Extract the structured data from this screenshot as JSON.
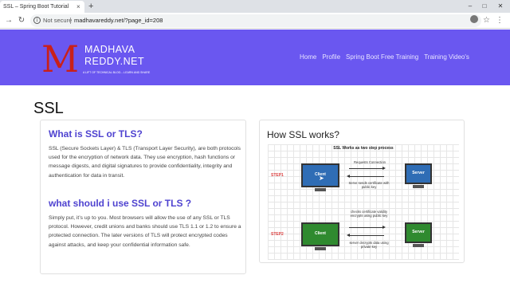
{
  "browser": {
    "tab_title": "SSL – Spring Boot Tutorial",
    "tab_close": "×",
    "new_tab": "+",
    "security_label": "Not secure",
    "url": "madhavareddy.net/?page_id=208",
    "win_min": "–",
    "win_max": "□",
    "win_close": "✕"
  },
  "site": {
    "logo_initial": "M",
    "logo_line1": "MADHAVA",
    "logo_line2": "REDDY.NET",
    "logo_tagline": "A LIFT OF TECHNICAL BLOG....LEARN AND SHARE",
    "nav": [
      "Home",
      "Profile",
      "Spring Boot Free Training",
      "Training Video's"
    ]
  },
  "page": {
    "title": "SSL"
  },
  "left_card": {
    "heading1": "What is SSL or TLS?",
    "para1": "SSL (Secure Sockets Layer) & TLS (Transport Layer Security), are both protocols used for the encryption of network data. They use encryption, hash functions or message digests, and digital signatures to provide confidentiality, integrity and authentication for data in transit.",
    "heading2": "what should i use SSL or TLS ?",
    "para2": "Simply put, it’s up to you. Most browsers will allow the use of any SSL or TLS protocol. However, credit unions and banks should use TLS 1.1 or 1.2 to ensure a protected connection. The later versions of TLS will protect encrypted codes against attacks, and keep your confidential information safe."
  },
  "right_card": {
    "heading": "How SSL works?",
    "diagram": {
      "title": "SSL Works as two step process",
      "step1": "STEP1",
      "step2": "STEP2",
      "client": "Client",
      "server": "Server",
      "s1_top": "Requests Connection",
      "s1_bottom": "Serve sends certificate with public key",
      "s2_top": "checks certificate validity encrypts using public key",
      "s2_bottom": "server decrypts data using private key",
      "step1_color": "#2f6db5",
      "step2_color": "#2f8a2f"
    }
  }
}
